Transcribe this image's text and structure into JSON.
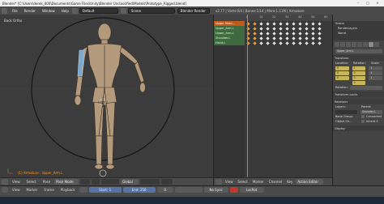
{
  "window": {
    "title": "Blender* [C:\\Users\\derek_000\\Documents\\Game Files\\Unity\\Blender Unclassified\\Models\\Prototype_Rigged.blend]",
    "controls": [
      "–",
      "□",
      "×"
    ]
  },
  "menubar": {
    "items": [
      "File",
      "Render",
      "Window",
      "Help"
    ],
    "screen_layout": "Default",
    "scene": "Scene",
    "render_engine": "Blender Render",
    "stats": "v2.77 | Verts:0/4 | Bones:1/14 | Mem:1.11M | Armature"
  },
  "viewport": {
    "label": "Back Ortho",
    "selection_info": "(1) Armature : Upper_Arm.L"
  },
  "viewport_header": {
    "items": [
      "View",
      "Select",
      "Pose",
      "Pose Mode",
      "Global"
    ]
  },
  "dopesheet": {
    "ruler": [
      "0",
      "10",
      "20",
      "30",
      "40",
      "50",
      "60"
    ],
    "channels": [
      {
        "name": "Upper Shou...",
        "kind": "sel"
      },
      {
        "name": "Upper_Arm.L",
        "kind": "grp"
      },
      {
        "name": "Upper_Arm.L",
        "kind": "grp"
      },
      {
        "name": "Shoulder.L",
        "kind": "grp"
      },
      {
        "name": "Hand.L",
        "kind": "grp"
      }
    ]
  },
  "dopesheet_header": {
    "items": [
      "View",
      "Select",
      "Marker",
      "Channel",
      "Key",
      "Action Editor"
    ]
  },
  "outliner": {
    "rows": [
      "Scene",
      "RenderLayers",
      "World"
    ]
  },
  "properties": {
    "object_name": "Upper_Arm.L",
    "panels": {
      "transform": "Transform",
      "location_label": "Location:",
      "rotation_label": "Rotation:",
      "scale_label": "Scale:",
      "rotation_mode": "Quaternion (...)",
      "transform_locks": "Transform Locks",
      "relations": "Relations",
      "layers_label": "Layers:",
      "parent_label": "Parent:",
      "parent_value": "Shoulder.L",
      "bone_group_label": "Bone Group:",
      "object_children_label": "Object Ch...",
      "connected_label": "Connected",
      "inherit_label": "Inherit S",
      "display": "Display"
    },
    "location": [
      "0",
      "0",
      "0"
    ],
    "rotation": [
      "1",
      "0",
      "0",
      "0"
    ],
    "scale": [
      "1",
      "1",
      "1"
    ]
  },
  "timeline": {
    "items": [
      "View",
      "Marker",
      "Frame",
      "Playback"
    ],
    "start_label": "Start:",
    "start_value": "1",
    "end_label": "End:",
    "end_value": "250",
    "current_frame": "0",
    "sync": "No Sync",
    "keying_set": "LocRot"
  },
  "colors": {
    "accent": "#e07a1a",
    "playhead": "#4fb34f",
    "viewport_bg": "#3c3c3c"
  }
}
